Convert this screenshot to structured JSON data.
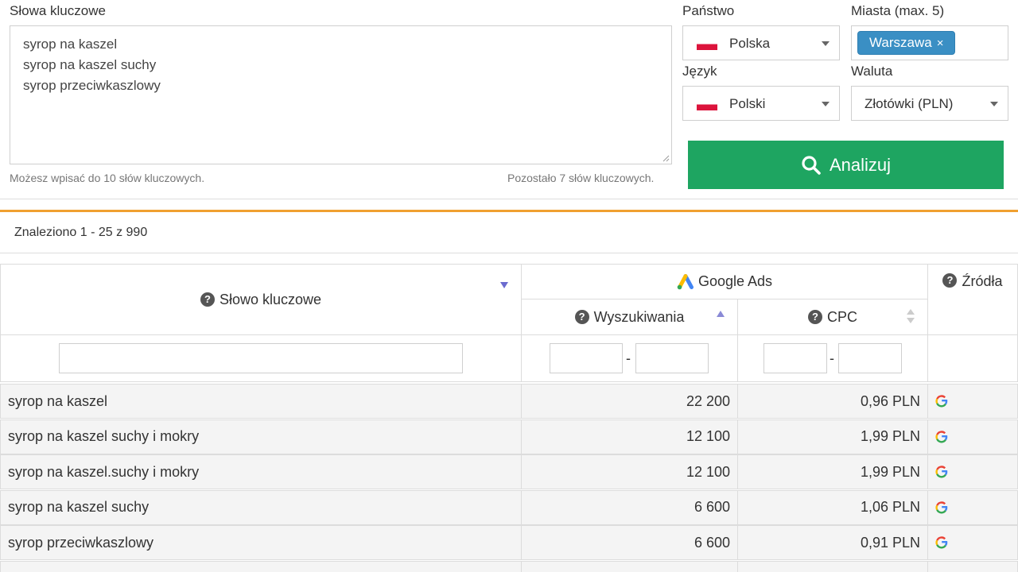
{
  "form": {
    "keywords_label": "Słowa kluczowe",
    "keywords": [
      "syrop na kaszel",
      "syrop na kaszel suchy",
      "syrop przeciwkaszlowy"
    ],
    "hint_left": "Możesz wpisać do 10 słów kluczowych.",
    "hint_right": "Pozostało 7 słów kluczowych.",
    "country_label": "Państwo",
    "country_value": "Polska",
    "cities_label": "Miasta (max. 5)",
    "city_tag": "Warszawa",
    "city_tag_remove": "×",
    "language_label": "Język",
    "language_value": "Polski",
    "currency_label": "Waluta",
    "currency_value": "Złotówki (PLN)",
    "analyze_label": "Analizuj"
  },
  "results": {
    "count_text": "Znaleziono 1 - 25 z 990"
  },
  "table": {
    "col_keyword": "Słowo kluczowe",
    "group_google_ads": "Google Ads",
    "col_searches": "Wyszukiwania",
    "col_cpc": "CPC",
    "col_sources": "Źródła",
    "range_dash": "-",
    "rows": [
      {
        "keyword": "syrop na kaszel",
        "searches": "22 200",
        "cpc": "0,96 PLN"
      },
      {
        "keyword": "syrop na kaszel suchy i mokry",
        "searches": "12 100",
        "cpc": "1,99 PLN"
      },
      {
        "keyword": "syrop na kaszel.suchy i mokry",
        "searches": "12 100",
        "cpc": "1,99 PLN"
      },
      {
        "keyword": "syrop na kaszel suchy",
        "searches": "6 600",
        "cpc": "1,06 PLN"
      },
      {
        "keyword": "syrop przeciwkaszlowy",
        "searches": "6 600",
        "cpc": "0,91 PLN"
      }
    ]
  },
  "icons": {
    "flag": "poland-flag-icon",
    "search": "search-icon",
    "help": "question-icon",
    "ads": "google-ads-icon",
    "source": "google-icon"
  },
  "colors": {
    "accent_green": "#1ea561",
    "tag_blue": "#3a8fc4",
    "divider_orange": "#f0a030"
  }
}
